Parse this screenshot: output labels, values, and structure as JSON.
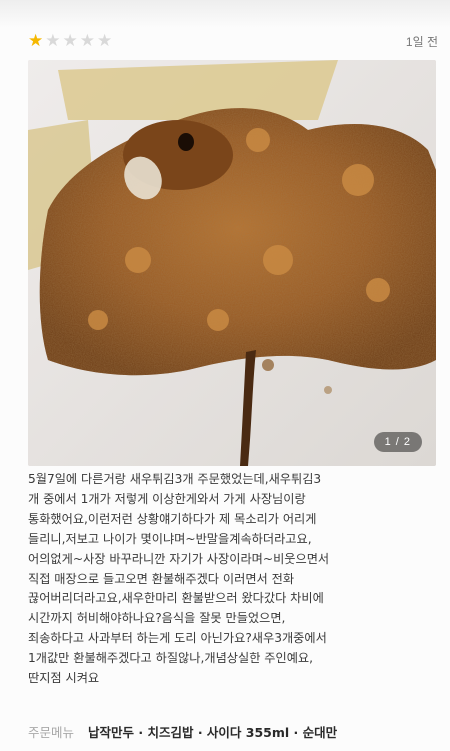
{
  "review": {
    "rating": 1,
    "max_rating": 5,
    "time_ago": "1일 전",
    "photo": {
      "page_indicator": "1 / 2"
    },
    "text_lines": [
      "5월7일에 다른거랑 새우튀김3개 주문했었는데,새우튀김3",
      "개 중에서 1개가 저렇게 이상한게와서 가게 사장님이랑",
      "통화했어요,이런저런 상황얘기하다가 제 목소리가 어리게",
      "들리니,저보고 나이가 몇이냐며~반말을계속하더라고요,",
      "어의없게~사장 바꾸라니깐 자기가 사장이라며~비웃으면서",
      "직접 매장으로 들고오면 환불해주겠다 이러면서 전화",
      "끊어버리더라고요,새우한마리 환불받으러 왔다갔다 차비에",
      "시간까지 허비해야하나요?음식을 잘못 만들었으면,",
      "죄송하다고 사과부터 하는게 도리 아닌가요?새우3개중에서",
      "1개값만 환불해주겠다고 하질않나,개념상실한 주인예요,",
      "딴지점 시켜요"
    ],
    "order": {
      "label": "주문메뉴",
      "items": "납작만두 · 치즈김밥 · 사이다 355ml · 순대만"
    }
  },
  "colors": {
    "star_filled": "#f5b800",
    "star_empty": "#d9d9d9",
    "label_gray": "#a8a8a8"
  }
}
